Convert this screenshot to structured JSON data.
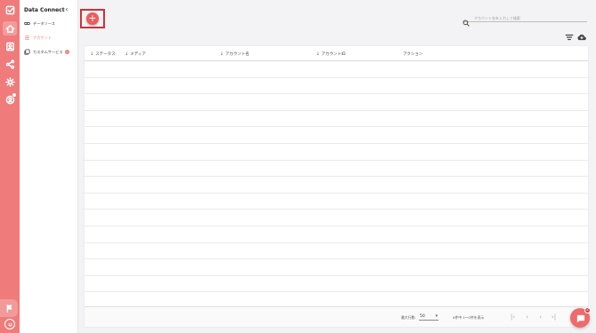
{
  "rail": {
    "icons": [
      "checkbox-icon",
      "home-icon",
      "contacts-icon",
      "share-icon",
      "settings-icon",
      "user-notification-icon",
      "flag-icon",
      "face-icon"
    ]
  },
  "sidebar": {
    "title": "Data Connect",
    "items": [
      {
        "label": "データソース",
        "icon": "link-icon"
      },
      {
        "label": "アカウント",
        "icon": "list-icon"
      },
      {
        "label": "カスタムサービス",
        "icon": "layers-icon",
        "badge": "?"
      }
    ]
  },
  "toolbar": {
    "add_label": "+",
    "search_placeholder": "アカウント名を入力して検索"
  },
  "table": {
    "columns": [
      "ステータス",
      "メディア",
      "アカウント名",
      "アカウントID",
      "アクション"
    ],
    "sortable": [
      true,
      true,
      true,
      true,
      false
    ],
    "rows": []
  },
  "pagination": {
    "rows_per_page_label": "最大行数:",
    "rows_per_page_value": "50",
    "range_label": "0件中 1～0件を表示"
  },
  "chat": {
    "badge": "2"
  },
  "colors": {
    "accent": "#ef7b7b",
    "highlight_border": "#d0303a"
  }
}
